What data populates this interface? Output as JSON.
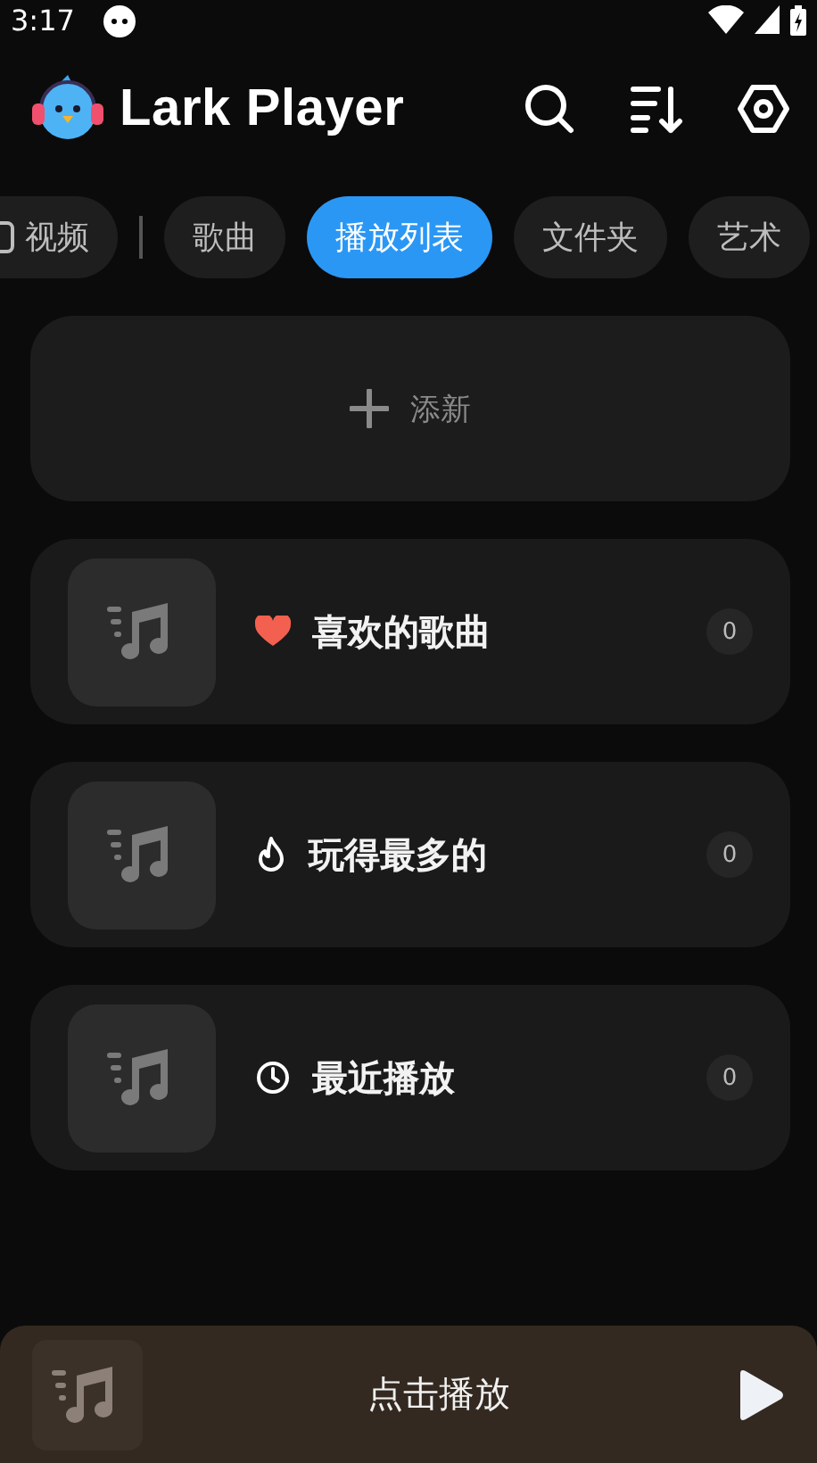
{
  "status_bar": {
    "time": "3:17"
  },
  "app_bar": {
    "title": "Lark Player"
  },
  "tabs": [
    {
      "label": "视频",
      "selected": false,
      "kind": "video"
    },
    {
      "label": "歌曲",
      "selected": false
    },
    {
      "label": "播放列表",
      "selected": true
    },
    {
      "label": "文件夹",
      "selected": false
    },
    {
      "label": "艺术",
      "selected": false
    }
  ],
  "add_card": {
    "label": "添新"
  },
  "playlists": [
    {
      "kind": "heart",
      "name": "喜欢的歌曲",
      "count": "0"
    },
    {
      "kind": "flame",
      "name": "玩得最多的",
      "count": "0"
    },
    {
      "kind": "clock",
      "name": "最近播放",
      "count": "0"
    }
  ],
  "mini_player": {
    "label": "点击播放"
  }
}
